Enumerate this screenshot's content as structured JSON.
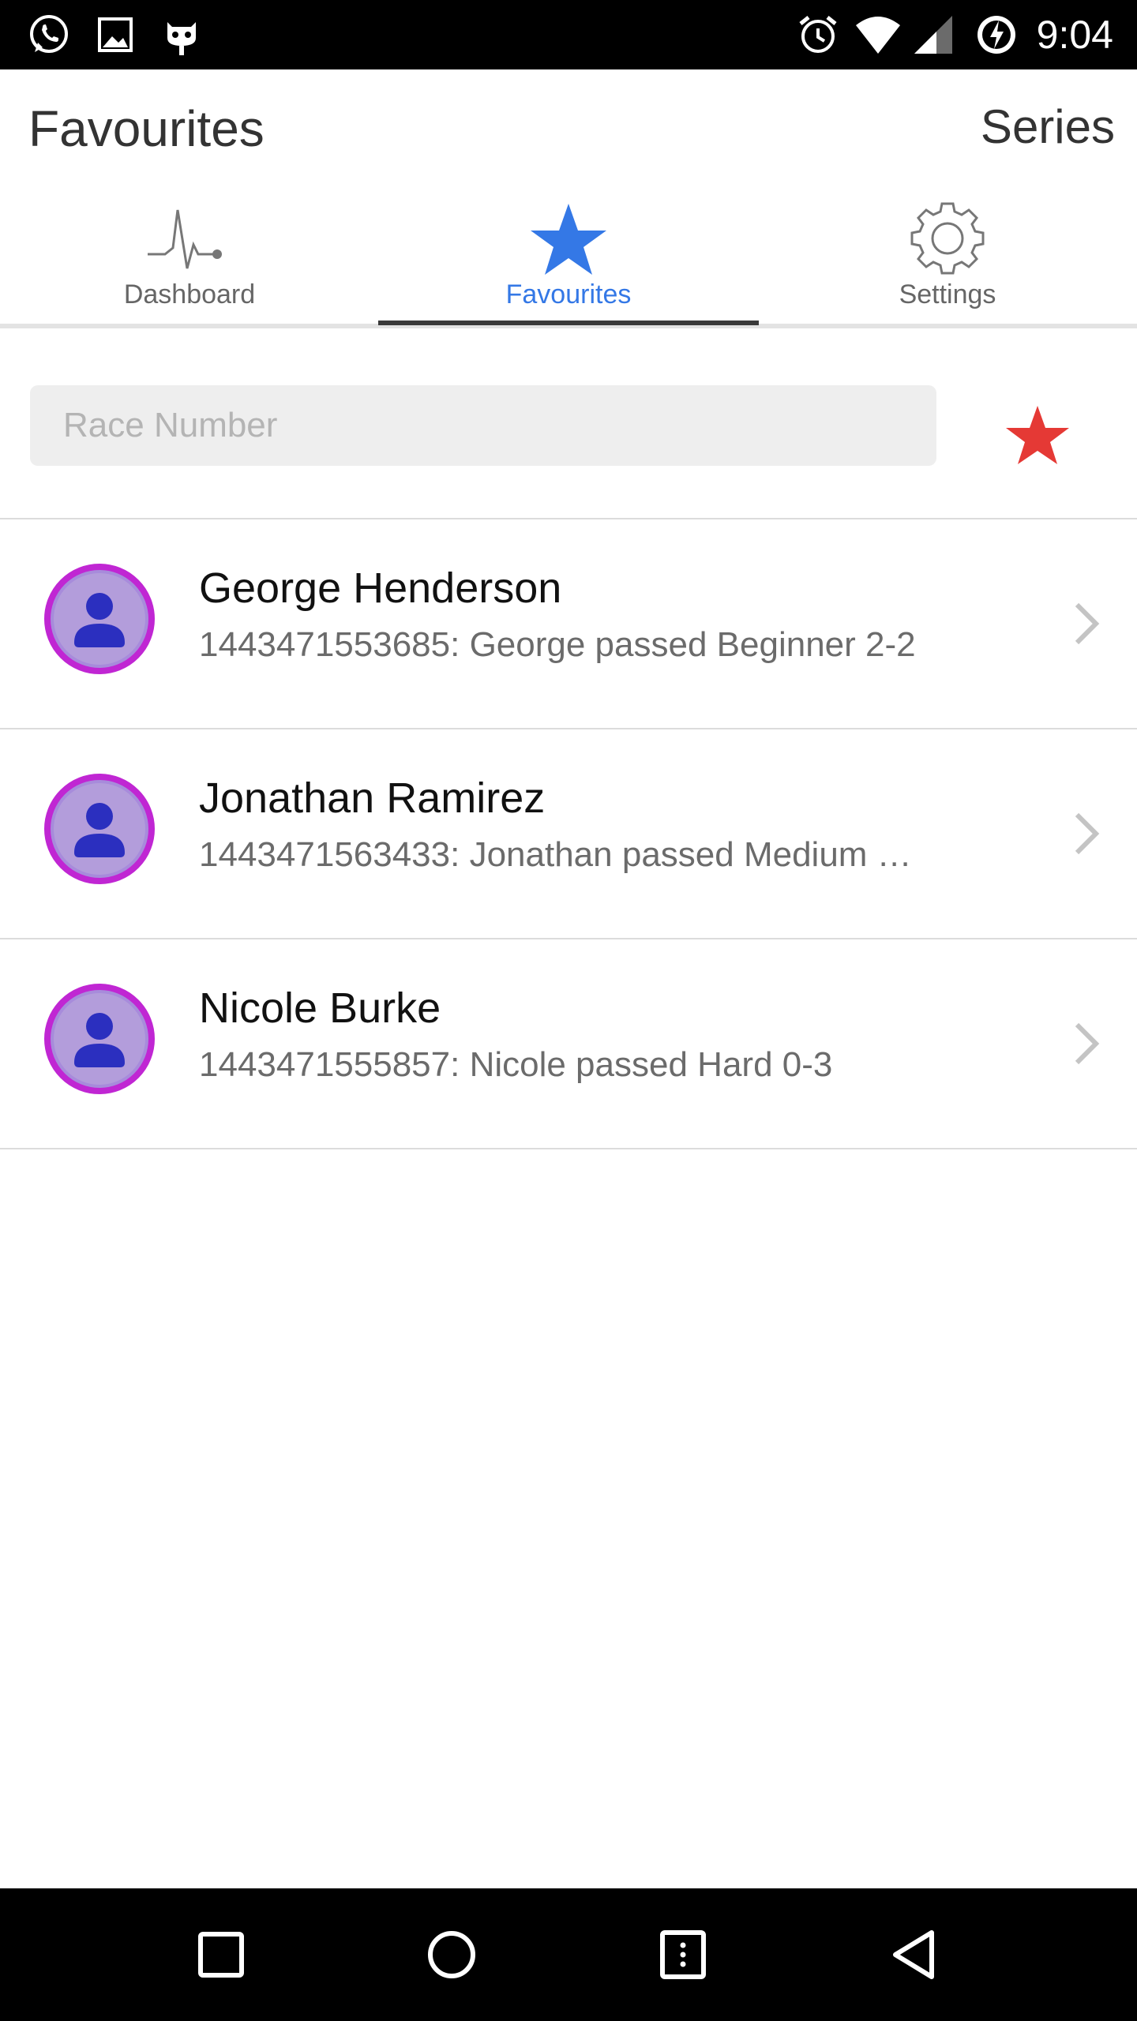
{
  "status_bar": {
    "time": "9:04",
    "left_icons": [
      "whatsapp-icon",
      "gallery-icon",
      "cyanogen-icon"
    ],
    "right_icons": [
      "alarm-icon",
      "wifi-icon",
      "signal-icon",
      "battery-charging-icon"
    ]
  },
  "header": {
    "title": "Favourites",
    "series_label": "Series"
  },
  "tabs": [
    {
      "label": "Dashboard",
      "icon": "pulse-icon",
      "active": false
    },
    {
      "label": "Favourites",
      "icon": "star-icon",
      "active": true
    },
    {
      "label": "Settings",
      "icon": "gear-icon",
      "active": false
    }
  ],
  "search": {
    "placeholder": "Race Number",
    "value": "",
    "favourite_icon": "star-icon"
  },
  "favourites": [
    {
      "name": "George Henderson",
      "status": "1443471553685: George passed Beginner 2-2"
    },
    {
      "name": "Jonathan Ramirez",
      "status": "1443471563433: Jonathan passed Medium …"
    },
    {
      "name": "Nicole Burke",
      "status": "1443471555857: Nicole passed Hard 0-3"
    }
  ],
  "nav_bar": {
    "buttons": [
      "recents-button",
      "home-button",
      "menu-button",
      "back-button"
    ]
  },
  "colors": {
    "accent": "#3478e6",
    "favourite_star": "#e53935",
    "avatar_ring": "#c026d3",
    "avatar_fill": "#a78bdb",
    "avatar_person": "#2b2fbf"
  }
}
